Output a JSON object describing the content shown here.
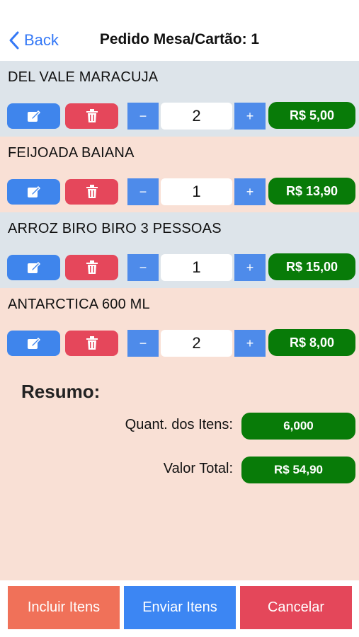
{
  "nav": {
    "back_label": "Back",
    "title": "Pedido Mesa/Cartão: 1"
  },
  "items": [
    {
      "name": "DEL VALE MARACUJA",
      "qty": "2",
      "price": "R$ 5,00"
    },
    {
      "name": "FEIJOADA BAIANA",
      "qty": "1",
      "price": "R$ 13,90"
    },
    {
      "name": "ARROZ BIRO BIRO 3 PESSOAS",
      "qty": "1",
      "price": "R$ 15,00"
    },
    {
      "name": "ANTARCTICA 600 ML",
      "qty": "2",
      "price": "R$ 8,00"
    }
  ],
  "controls": {
    "minus": "−",
    "plus": "+"
  },
  "summary": {
    "title": "Resumo:",
    "qty_label": "Quant. dos Itens:",
    "qty_value": "6,000",
    "total_label": "Valor Total:",
    "total_value": "R$ 54,90"
  },
  "footer": {
    "include": "Incluir Itens",
    "send": "Enviar Itens",
    "cancel": "Cancelar"
  },
  "colors": {
    "accent": "#3478f6",
    "price_green": "#087b08",
    "row_blue": "#dde4ea",
    "row_peach": "#f9e0d5",
    "delete_red": "#e5475b",
    "include_orange": "#f07159"
  },
  "icons": {
    "edit": "edit-icon",
    "delete": "trash-icon",
    "back": "chevron-left-icon"
  }
}
